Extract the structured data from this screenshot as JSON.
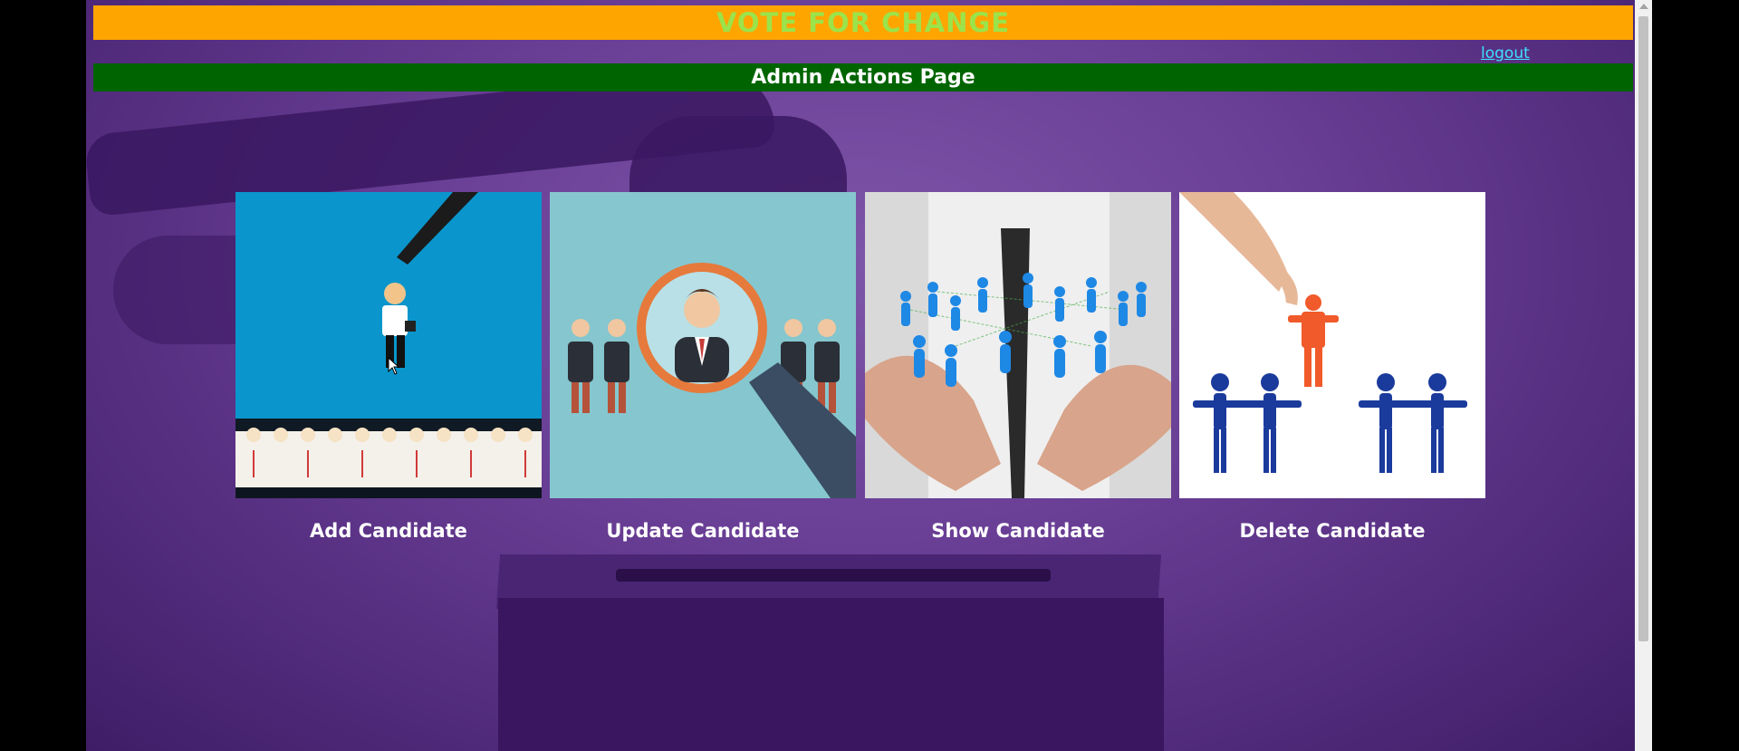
{
  "header": {
    "site_title": "VOTE FOR CHANGE",
    "logout_label": "logout",
    "page_title": "Admin Actions Page"
  },
  "actions": [
    {
      "label": "Add Candidate",
      "icon": "add-candidate-illustration"
    },
    {
      "label": "Update Candidate",
      "icon": "magnifier-candidate-illustration"
    },
    {
      "label": "Show Candidate",
      "icon": "network-people-illustration"
    },
    {
      "label": "Delete Candidate",
      "icon": "remove-person-illustration"
    }
  ],
  "colors": {
    "title_bar": "#ffa500",
    "title_text": "#9be34a",
    "subtitle_bar": "#006400",
    "logout_link": "#3ee1ff",
    "background": "#6a3f96"
  }
}
